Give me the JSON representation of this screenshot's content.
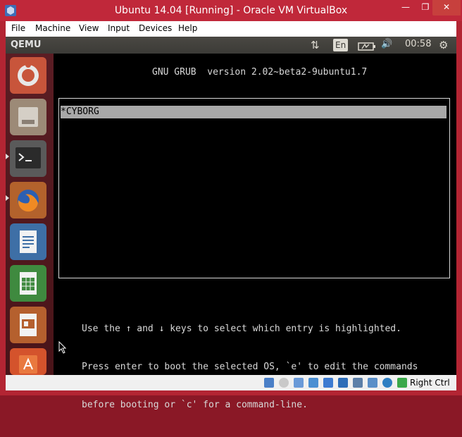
{
  "window": {
    "title": "Ubuntu 14.04 [Running] - Oracle VM VirtualBox",
    "minimize_glyph": "—",
    "maximize_glyph": "❐",
    "close_glyph": "✕"
  },
  "menubar": {
    "items": [
      "File",
      "Machine",
      "View",
      "Input",
      "Devices",
      "Help"
    ]
  },
  "guest_panel": {
    "title": "QEMU",
    "network_glyph": "⇅",
    "keyboard_layout": "En",
    "volume_glyph": "🔊",
    "clock": "00:58",
    "settings_glyph": "⚙"
  },
  "grub": {
    "header": "GNU GRUB  version 2.02~beta2-9ubuntu1.7",
    "entries": [
      "*CYBORG"
    ],
    "help_lines": [
      "Use the ↑ and ↓ keys to select which entry is highlighted.",
      "Press enter to boot the selected OS, `e' to edit the commands",
      "before booting or `c' for a command-line."
    ]
  },
  "statusbar": {
    "host_key": "Right Ctrl"
  }
}
